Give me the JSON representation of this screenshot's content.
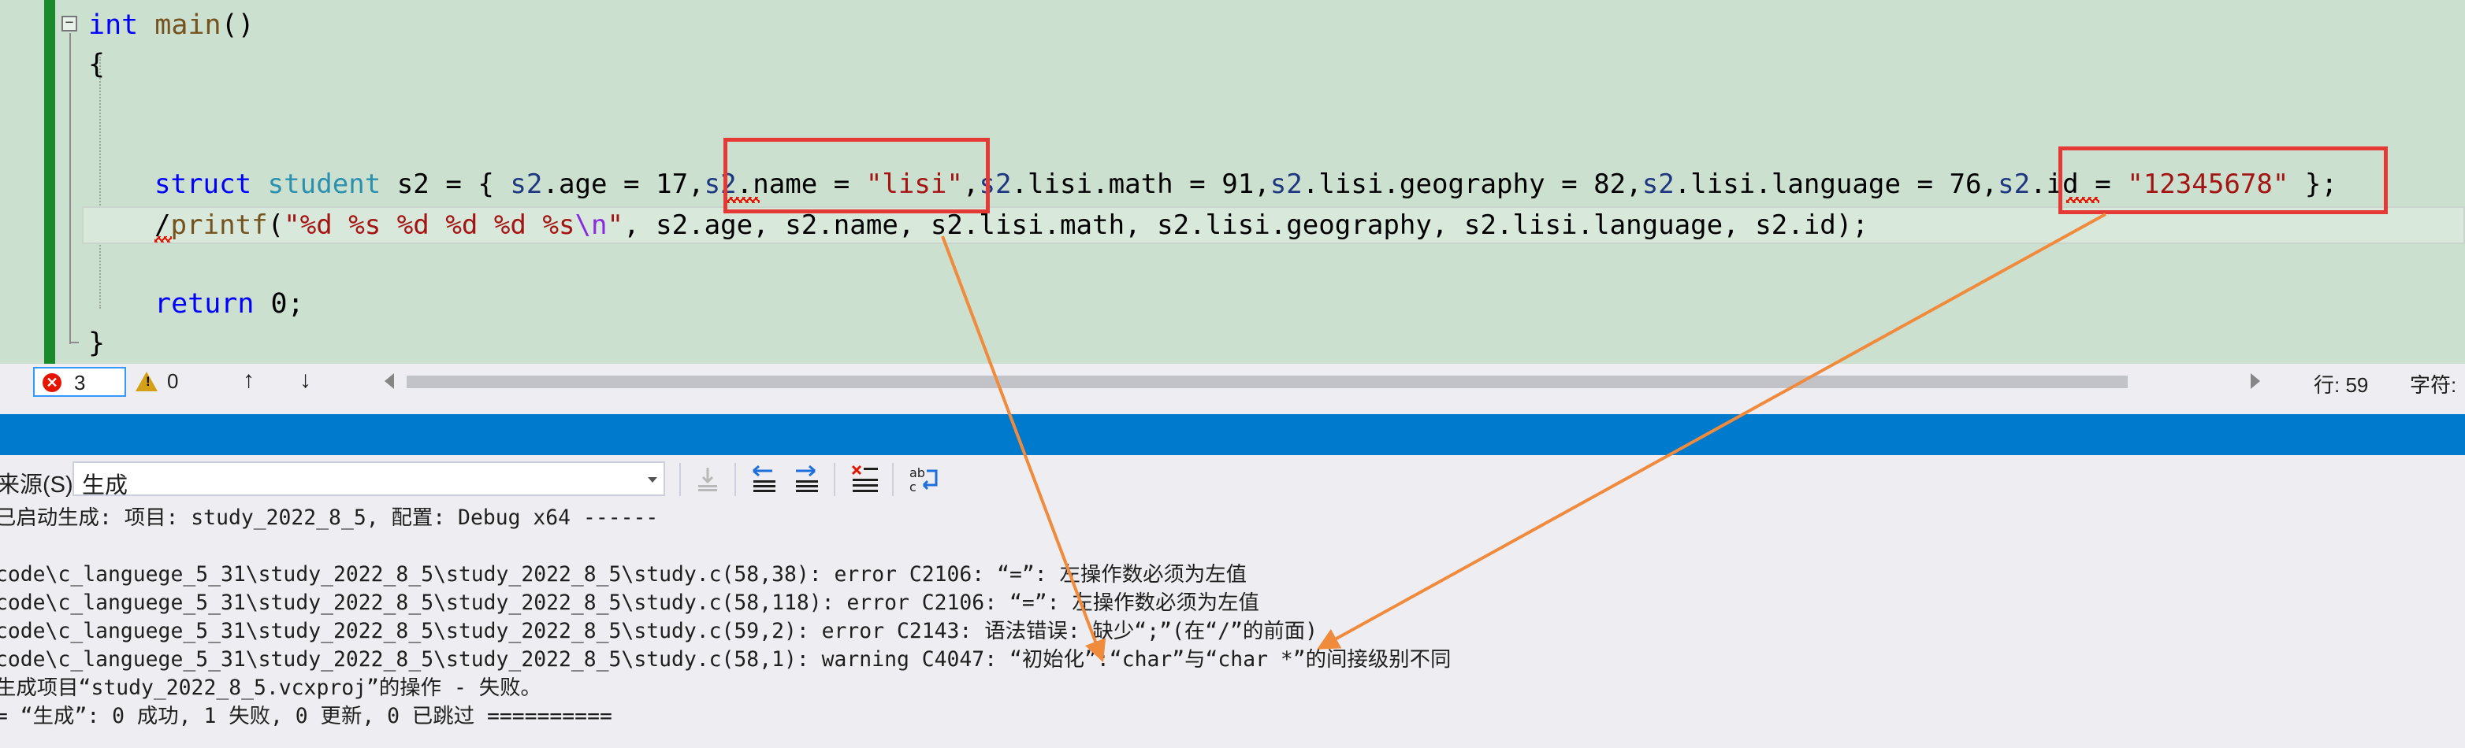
{
  "editor": {
    "line_main": {
      "kw": "int",
      "fn": "main",
      "rest": "()"
    },
    "open_brace": "{",
    "struct_line": {
      "kw": "struct",
      "type": "student",
      "p1": " s2 = { ",
      "v1": "s2",
      "p2": ".age = 17,",
      "v2": "s2",
      "p3": ".name = ",
      "s1": "\"lisi\"",
      "p4": ",",
      "v3": "s2",
      "p5": ".lisi.math = 91,",
      "v4": "s2",
      "p6": ".lisi.geography = 82,",
      "v5": "s2",
      "p7": ".lisi.language = 76,",
      "v6": "s2",
      "p8": ".id = ",
      "s2": "\"12345678\"",
      "p9": " };"
    },
    "printf_line": {
      "slash": "/",
      "fn": "printf",
      "p1": "(",
      "s1": "\"%d %s %d %d %d %s",
      "esc": "\\n",
      "s2": "\"",
      "p2": ", s2.age, s2.name, s2.lisi.math, s2.lisi.geography, s2.lisi.language, s2.id);"
    },
    "return_line": {
      "kw": "return",
      "rest": " 0;"
    },
    "close_brace": "}",
    "collapse_glyph": "−"
  },
  "status": {
    "error_count": "3",
    "warning_count": "0",
    "warning_mark": "!",
    "error_mark": "✕",
    "up_arrow": "↑",
    "down_arrow": "↓",
    "line_indicator": "行: 59",
    "char_indicator": "字符:"
  },
  "output": {
    "source_label": "来源(S):",
    "source_value": "生成",
    "toolbar_icons": [
      "find-message-icon",
      "go-previous-icon",
      "go-next-icon",
      "clear-all-icon",
      "toggle-word-wrap-icon"
    ],
    "lines": [
      "已启动生成: 项目: study_2022_8_5, 配置: Debug x64 ------",
      "",
      "code\\c_languege_5_31\\study_2022_8_5\\study_2022_8_5\\study.c(58,38): error C2106: “=”: 左操作数必须为左值",
      "code\\c_languege_5_31\\study_2022_8_5\\study_2022_8_5\\study.c(58,118): error C2106: “=”: 左操作数必须为左值",
      "code\\c_languege_5_31\\study_2022_8_5\\study_2022_8_5\\study.c(59,2): error C2143: 语法错误: 缺少“;”(在“/”的前面)",
      "code\\c_languege_5_31\\study_2022_8_5\\study_2022_8_5\\study.c(58,1): warning C4047: “初始化”:“char”与“char *”的间接级别不同",
      "生成项目“study_2022_8_5.vcxproj”的操作 - 失败。",
      "= “生成”: 0 成功, 1 失败, 0 更新, 0 已跳过 =========="
    ]
  },
  "colors": {
    "editor_bg": "#cce0cf",
    "accent_blue": "#007acc",
    "highlight_box": "#e53935",
    "arrow": "#f08a3c",
    "error_red": "#e51400"
  }
}
